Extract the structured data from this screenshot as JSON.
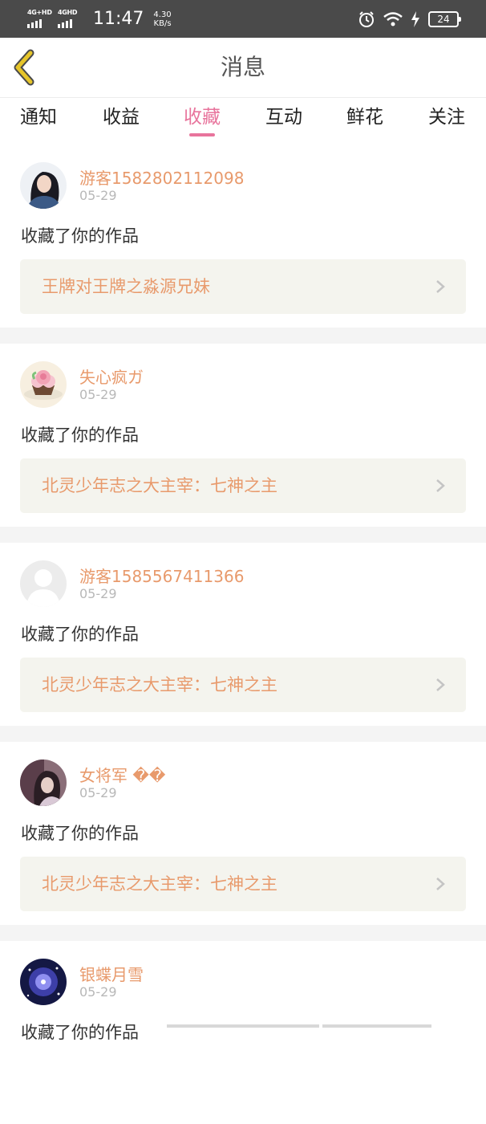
{
  "status_bar": {
    "net1_label": "4G+HD",
    "net2_label": "4GHD",
    "time": "11:47",
    "speed_value": "4.30",
    "speed_unit": "KB/s",
    "battery": "24",
    "icons": [
      "alarm-icon",
      "wifi-icon",
      "charging-icon",
      "battery-icon"
    ]
  },
  "header": {
    "title": "消息",
    "back_icon": "chevron-left-icon"
  },
  "tabs": [
    {
      "label": "通知"
    },
    {
      "label": "收益"
    },
    {
      "label": "收藏",
      "active": true
    },
    {
      "label": "互动"
    },
    {
      "label": "鲜花"
    },
    {
      "label": "关注"
    }
  ],
  "messages": [
    {
      "username": "游客1582802112098",
      "date": "05-29",
      "action": "收藏了你的作品",
      "work": "王牌对王牌之淼源兄妹",
      "avatar": "photo-girl"
    },
    {
      "username": "失心疯ガ",
      "date": "05-29",
      "action": "收藏了你的作品",
      "work": "北灵少年志之大主宰：七神之主",
      "avatar": "cupcake"
    },
    {
      "username": "游客1585567411366",
      "date": "05-29",
      "action": "收藏了你的作品",
      "work": "北灵少年志之大主宰：七神之主",
      "avatar": "default-user"
    },
    {
      "username": "女将军 ��",
      "date": "05-29",
      "action": "收藏了你的作品",
      "work": "北灵少年志之大主宰：七神之主",
      "avatar": "photo-dark"
    },
    {
      "username": "银蝶月雪",
      "date": "05-29",
      "action": "收藏了你的作品",
      "work": "",
      "avatar": "galaxy"
    }
  ],
  "colors": {
    "accent": "#e8749c",
    "username": "#e89a6c",
    "back_icon": "#e6c52a",
    "status_bar": "#4a4a4a",
    "work_box": "#f4f4ee"
  }
}
